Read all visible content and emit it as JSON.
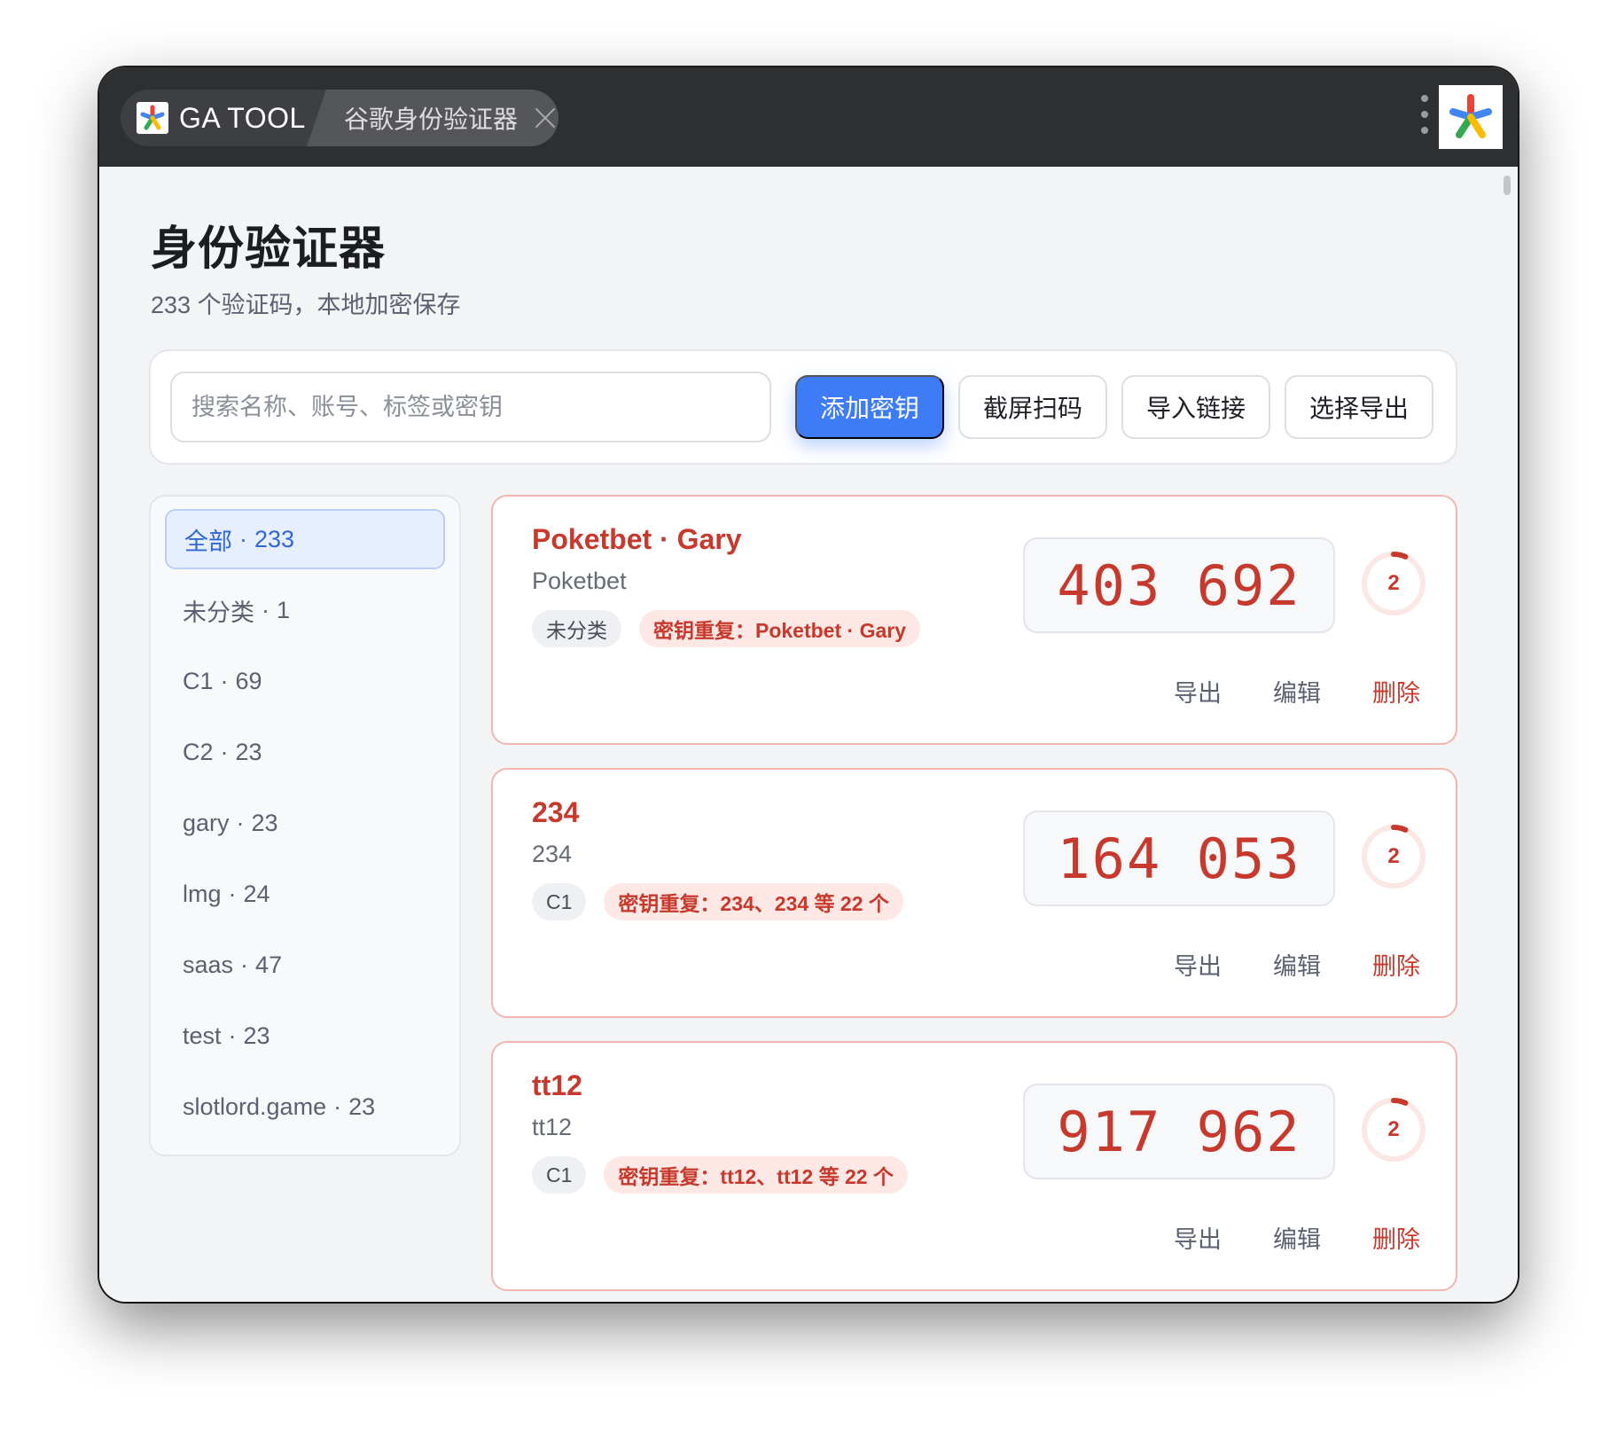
{
  "titlebar": {
    "home_tab_label": "GA TOOL",
    "current_tab_label": "谷歌身份验证器"
  },
  "page": {
    "title": "身份验证器",
    "subtitle": "233 个验证码，本地加密保存"
  },
  "toolbar": {
    "search_placeholder": "搜索名称、账号、标签或密钥",
    "add_key_label": "添加密钥",
    "scan_label": "截屏扫码",
    "import_label": "导入链接",
    "export_label": "选择导出"
  },
  "sidebar": {
    "items": [
      {
        "label": "全部",
        "count": "233",
        "active": true
      },
      {
        "label": "未分类",
        "count": "1"
      },
      {
        "label": "C1",
        "count": "69"
      },
      {
        "label": "C2",
        "count": "23"
      },
      {
        "label": "gary",
        "count": "23"
      },
      {
        "label": "lmg",
        "count": "24"
      },
      {
        "label": "saas",
        "count": "47"
      },
      {
        "label": "test",
        "count": "23"
      },
      {
        "label": "slotlord.game",
        "count": "23"
      }
    ]
  },
  "cards": [
    {
      "name": "Poketbet · Gary",
      "issuer": "Poketbet",
      "tag": "未分类",
      "warning": "密钥重复：Poketbet · Gary",
      "code": "403 692",
      "seconds": "2",
      "actions": {
        "export": "导出",
        "edit": "编辑",
        "delete": "删除"
      }
    },
    {
      "name": "234",
      "issuer": "234",
      "tag": "C1",
      "warning": "密钥重复：234、234 等 22 个",
      "code": "164 053",
      "seconds": "2",
      "actions": {
        "export": "导出",
        "edit": "编辑",
        "delete": "删除"
      }
    },
    {
      "name": "tt12",
      "issuer": "tt12",
      "tag": "C1",
      "warning": "密钥重复：tt12、tt12 等 22 个",
      "code": "917 962",
      "seconds": "2",
      "actions": {
        "export": "导出",
        "edit": "编辑",
        "delete": "删除"
      }
    }
  ],
  "colors": {
    "accent": "#3d7bf7",
    "danger": "#c7392c",
    "titlebar": "#2e2f31"
  },
  "icons": {
    "app_logo": "google-authenticator-asterisk-icon",
    "close": "close-icon",
    "menu": "kebab-menu-icon"
  }
}
